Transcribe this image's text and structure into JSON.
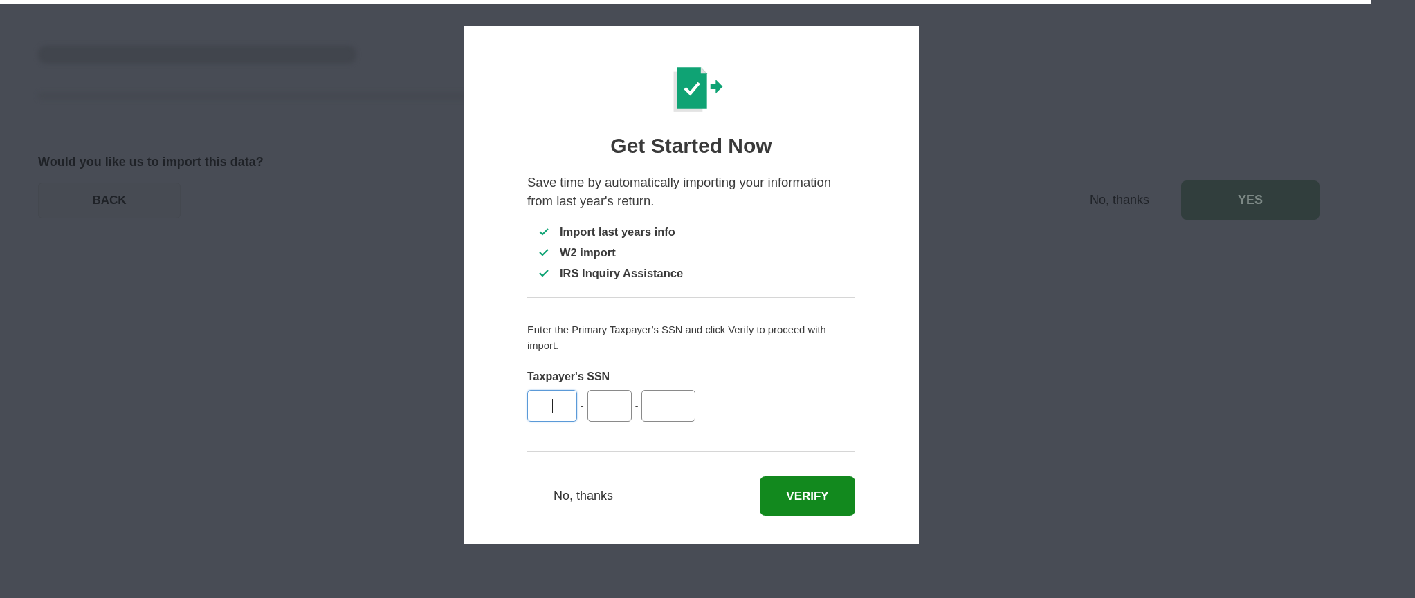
{
  "background": {
    "question": "Would you like us to import this data?",
    "back_button": "BACK",
    "no_thanks_link": "No, thanks",
    "yes_button": "YES"
  },
  "modal": {
    "title": "Get Started Now",
    "description": "Save time by automatically importing your information from last year's return.",
    "features": [
      {
        "label": "Import last years info",
        "checked": true
      },
      {
        "label": "W2 import",
        "checked": true
      },
      {
        "label": "IRS Inquiry Assistance",
        "checked": true
      }
    ],
    "instruction": "Enter the Primary Taxpayer’s SSN and click Verify to proceed with import.",
    "ssn": {
      "label": "Taxpayer's SSN",
      "fields": [
        {
          "focused": true
        },
        {
          "focused": false
        },
        {
          "focused": false
        }
      ],
      "separators": [
        "-",
        "-"
      ]
    },
    "no_thanks_link": "No, thanks",
    "verify_button": "VERIFY"
  }
}
